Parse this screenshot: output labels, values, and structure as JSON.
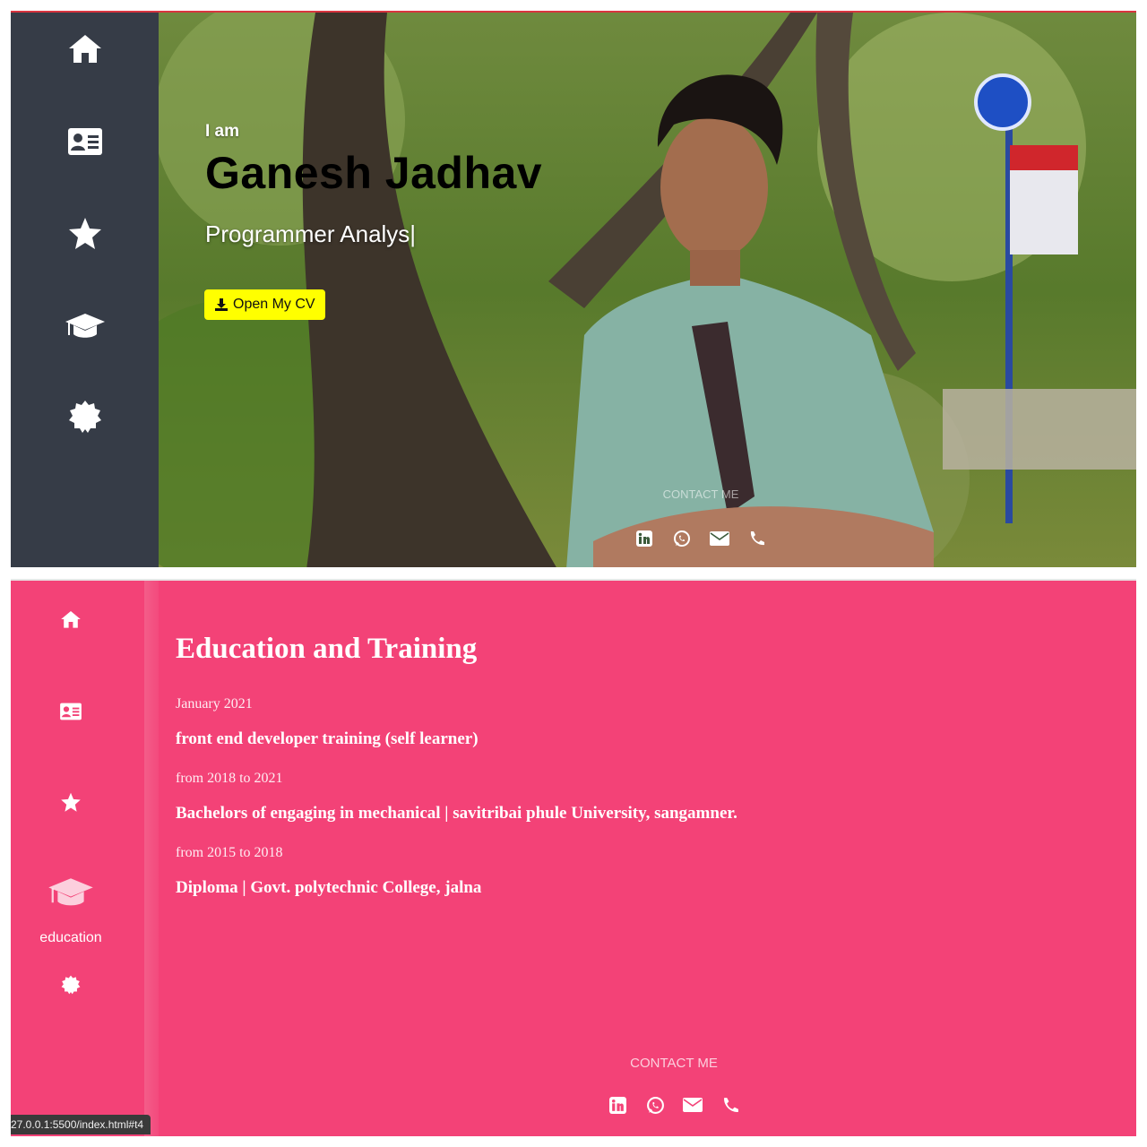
{
  "hero": {
    "intro": "I am",
    "name": "Ganesh Jadhav",
    "role": "Programmer Analys|",
    "cv_button": "Open My CV"
  },
  "sidebar_top": {
    "items": [
      {
        "icon": "home-icon"
      },
      {
        "icon": "id-card-icon"
      },
      {
        "icon": "star-icon"
      },
      {
        "icon": "graduation-cap-icon"
      },
      {
        "icon": "badge-icon"
      }
    ]
  },
  "sidebar_bottom": {
    "items": [
      {
        "icon": "home-icon"
      },
      {
        "icon": "id-card-icon"
      },
      {
        "icon": "star-icon"
      },
      {
        "icon": "graduation-cap-icon",
        "label": "education"
      },
      {
        "icon": "badge-icon"
      }
    ]
  },
  "contact": {
    "label": "CONTACT ME",
    "icons": [
      "linkedin-icon",
      "whatsapp-icon",
      "envelope-icon",
      "phone-icon"
    ]
  },
  "education": {
    "title": "Education and Training",
    "entries": [
      {
        "date": "January 2021",
        "title": "front end developer training (self learner)"
      },
      {
        "date": "from 2018 to 2021",
        "title": "Bachelors of engaging in mechanical | savitribai phule University, sangamner."
      },
      {
        "date": "from 2015 to 2018",
        "title": "Diploma | Govt. polytechnic College, jalna"
      }
    ]
  },
  "status_bar": {
    "url": "27.0.0.1:5500/index.html#t4"
  },
  "colors": {
    "sidebar_dark": "#363c47",
    "pink": "#f34277",
    "cv_button": "#ffff00",
    "accent_line": "#d9343f"
  }
}
